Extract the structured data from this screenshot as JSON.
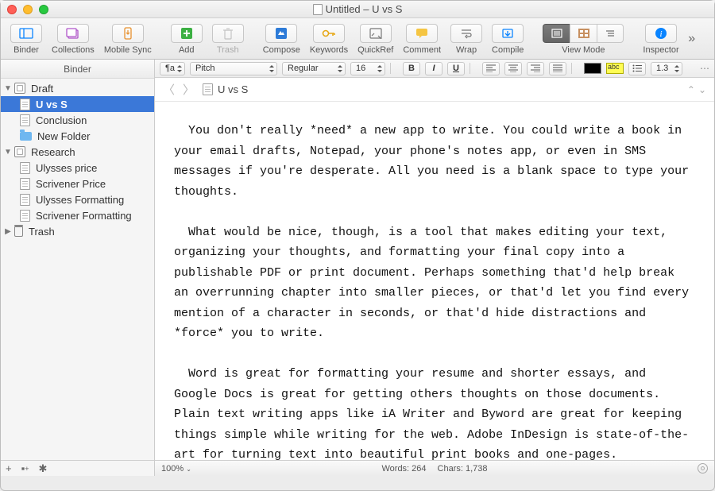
{
  "window": {
    "title": "Untitled – U vs S"
  },
  "toolbar": {
    "binder": "Binder",
    "collections": "Collections",
    "mobile_sync": "Mobile Sync",
    "add": "Add",
    "trash": "Trash",
    "compose": "Compose",
    "keywords": "Keywords",
    "quickref": "QuickRef",
    "comment": "Comment",
    "wrap": "Wrap",
    "compile": "Compile",
    "view_mode": "View Mode",
    "inspector": "Inspector"
  },
  "sidebar": {
    "header": "Binder",
    "items": [
      {
        "label": "Draft",
        "type": "binder",
        "level": 1,
        "expanded": true,
        "selected": false
      },
      {
        "label": "U vs S",
        "type": "doc",
        "level": 2,
        "expanded": false,
        "selected": true
      },
      {
        "label": "Conclusion",
        "type": "doc",
        "level": 2,
        "expanded": false,
        "selected": false
      },
      {
        "label": "New Folder",
        "type": "folder",
        "level": 2,
        "expanded": false,
        "selected": false
      },
      {
        "label": "Research",
        "type": "binder",
        "level": 1,
        "expanded": true,
        "selected": false
      },
      {
        "label": "Ulysses price",
        "type": "doc",
        "level": 2,
        "expanded": false,
        "selected": false
      },
      {
        "label": "Scrivener Price",
        "type": "doc",
        "level": 2,
        "expanded": false,
        "selected": false
      },
      {
        "label": "Ulysses Formatting",
        "type": "doc",
        "level": 2,
        "expanded": false,
        "selected": false
      },
      {
        "label": "Scrivener Formatting",
        "type": "doc",
        "level": 2,
        "expanded": false,
        "selected": false
      },
      {
        "label": "Trash",
        "type": "trash",
        "level": 1,
        "expanded": false,
        "selected": false
      }
    ]
  },
  "format_bar": {
    "paragraph_icon": "¶a",
    "font": "Pitch",
    "weight": "Regular",
    "size": "16",
    "bold": "B",
    "italic": "I",
    "underline": "U",
    "text_color": "#000000",
    "highlight": "abc",
    "line_spacing": "1.3"
  },
  "header": {
    "doc_title": "U vs S"
  },
  "editor": {
    "text": "  You don't really *need* a new app to write. You could write a book in your email drafts, Notepad, your phone's notes app, or even in SMS messages if you're desperate. All you need is a blank space to type your thoughts.\n\n  What would be nice, though, is a tool that makes editing your text, organizing your thoughts, and formatting your final copy into a publishable PDF or print document. Perhaps something that'd help break an overrunning chapter into smaller pieces, or that'd let you find every mention of a character in seconds, or that'd hide distractions and *force* you to write.\n\n  Word is great for formatting your resume and shorter essays, and Google Docs is great for getting others thoughts on those documents. Plain text writing apps like iA Writer and Byword are great for keeping things simple while writing for the web. Adobe InDesign is state-of-the-art for turning text into beautiful print books and one-pages."
  },
  "status": {
    "zoom": "100%",
    "words": "Words: 264",
    "chars": "Chars: 1,738"
  }
}
